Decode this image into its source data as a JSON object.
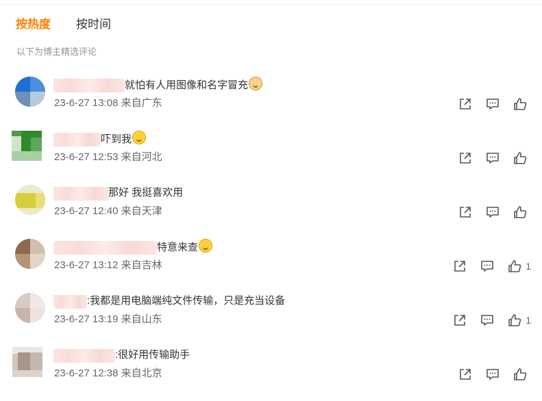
{
  "sort_tabs": [
    {
      "label": "按热度",
      "active": true
    },
    {
      "label": "按时间",
      "active": false
    }
  ],
  "section_label": "以下为博主精选评论",
  "comments": [
    {
      "text": "就怕有人用图像和名字冒充",
      "emoji": "dog-face-emoji",
      "meta": "23-6-27 13:08 来自广东",
      "likes": ""
    },
    {
      "text": "吓到我",
      "emoji": "smiling-face-emoji",
      "meta": "23-6-27 12:53 来自河北",
      "likes": ""
    },
    {
      "text": "那好 我挺喜欢用",
      "emoji": "",
      "meta": "23-6-27 12:40 来自天津",
      "likes": ""
    },
    {
      "text": "特意来查",
      "emoji": "crying-laughing-emoji",
      "meta": "23-6-27 13:12 来自吉林",
      "likes": "1"
    },
    {
      "text": ":我都是用电脑端纯文件传输，只是充当设备",
      "emoji": "",
      "meta": "23-6-27 13:19 来自山东",
      "likes": "1"
    },
    {
      "text": ":很好用传输助手",
      "emoji": "",
      "meta": "23-6-27 12:38 来自北京",
      "likes": ""
    }
  ],
  "icons": {
    "share": "share-icon",
    "comment": "comment-icon",
    "like": "thumbs-up-icon"
  },
  "colors": {
    "accent": "#ff8200",
    "meta_text": "#666666",
    "label_text": "#939393"
  }
}
